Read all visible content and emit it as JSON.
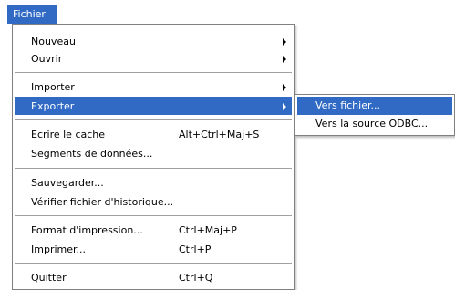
{
  "menubar": {
    "fichier_label": "Fichier"
  },
  "menu": {
    "nouveau": {
      "label": "Nouveau"
    },
    "ouvrir": {
      "label": "Ouvrir"
    },
    "importer": {
      "label": "Importer"
    },
    "exporter": {
      "label": "Exporter"
    },
    "ecrire_cache": {
      "label": "Ecrire le cache",
      "shortcut": "Alt+Ctrl+Maj+S"
    },
    "segments": {
      "label": "Segments de données..."
    },
    "sauvegarder": {
      "label": "Sauvegarder..."
    },
    "verifier": {
      "label": "Vérifier fichier d'historique..."
    },
    "format_impression": {
      "label": "Format d'impression...",
      "shortcut": "Ctrl+Maj+P"
    },
    "imprimer": {
      "label": "Imprimer...",
      "shortcut": "Ctrl+P"
    },
    "quitter": {
      "label": "Quitter",
      "shortcut": "Ctrl+Q"
    }
  },
  "submenu_exporter": {
    "vers_fichier": {
      "label": "Vers fichier..."
    },
    "vers_odbc": {
      "label": "Vers la source ODBC..."
    }
  },
  "colors": {
    "highlight": "#316ac5",
    "border": "#808080",
    "separator": "#a0a0a0"
  }
}
